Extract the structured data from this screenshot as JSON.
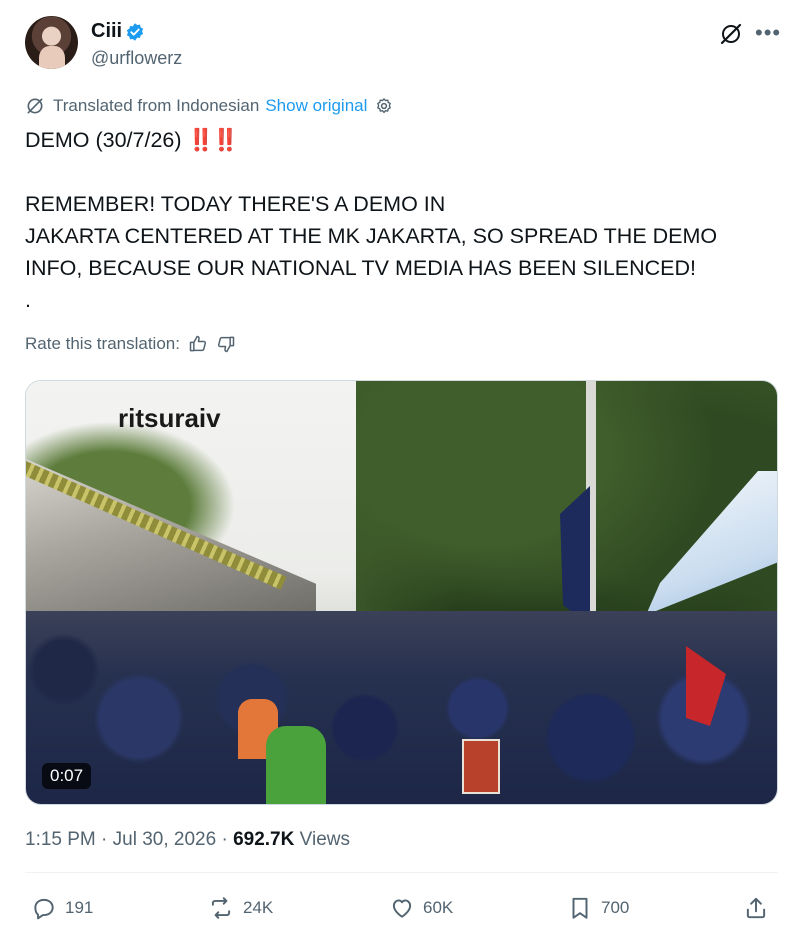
{
  "author": {
    "name": "Ciii",
    "handle": "@urflowerz",
    "verified": true
  },
  "translation": {
    "label": "Translated from Indonesian",
    "show_original": "Show original",
    "rate_label": "Rate this translation:"
  },
  "tweet": {
    "line1_text": "DEMO (30/7/26) ",
    "line1_emphasis": "‼️‼️",
    "body": "REMEMBER! TODAY THERE'S A DEMO IN\nJAKARTA CENTERED AT THE MK JAKARTA, SO SPREAD THE DEMO\nINFO, BECAUSE OUR NATIONAL TV MEDIA HAS BEEN SILENCED!\n."
  },
  "media": {
    "watermark": "ritsuraiv",
    "duration": "0:07"
  },
  "meta": {
    "time": "1:15 PM",
    "separator": " · ",
    "date": "Jul 30, 2026",
    "views_count": "692.7K",
    "views_label": " Views"
  },
  "actions": {
    "replies": "191",
    "reposts": "24K",
    "likes": "60K",
    "bookmarks": "700"
  },
  "colors": {
    "accent": "#1d9bf0",
    "text_primary": "#0f1419",
    "text_secondary": "#536471",
    "emphasis": "#d0263a"
  },
  "icons": [
    "verified-badge-icon",
    "grok-icon",
    "more-icon",
    "translate-icon",
    "settings-icon",
    "thumbs-up-icon",
    "thumbs-down-icon",
    "reply-icon",
    "repost-icon",
    "like-icon",
    "bookmark-icon",
    "share-icon"
  ]
}
